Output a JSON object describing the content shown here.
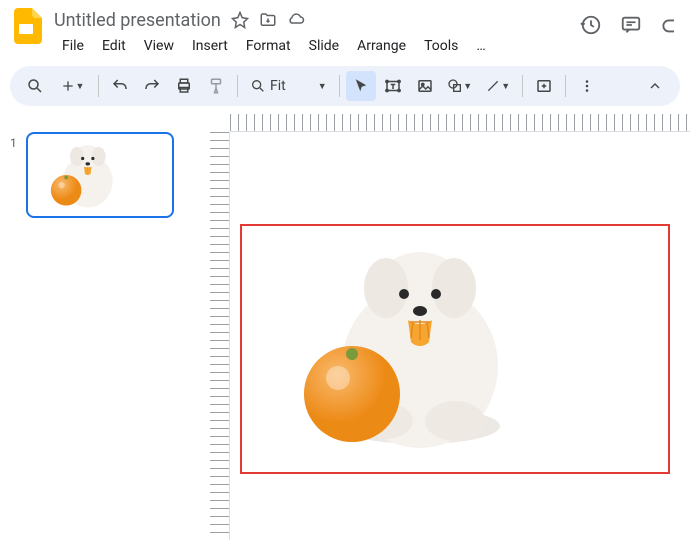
{
  "doc": {
    "title": "Untitled presentation"
  },
  "menus": {
    "file": "File",
    "edit": "Edit",
    "view": "View",
    "insert": "Insert",
    "format": "Format",
    "slide": "Slide",
    "arrange": "Arrange",
    "tools": "Tools",
    "more": "…"
  },
  "toolbar": {
    "zoom_label": "Fit"
  },
  "filmstrip": {
    "slide1_num": "1"
  },
  "canvas": {
    "selected_image_desc": "white fluffy dog with orange fruit"
  }
}
